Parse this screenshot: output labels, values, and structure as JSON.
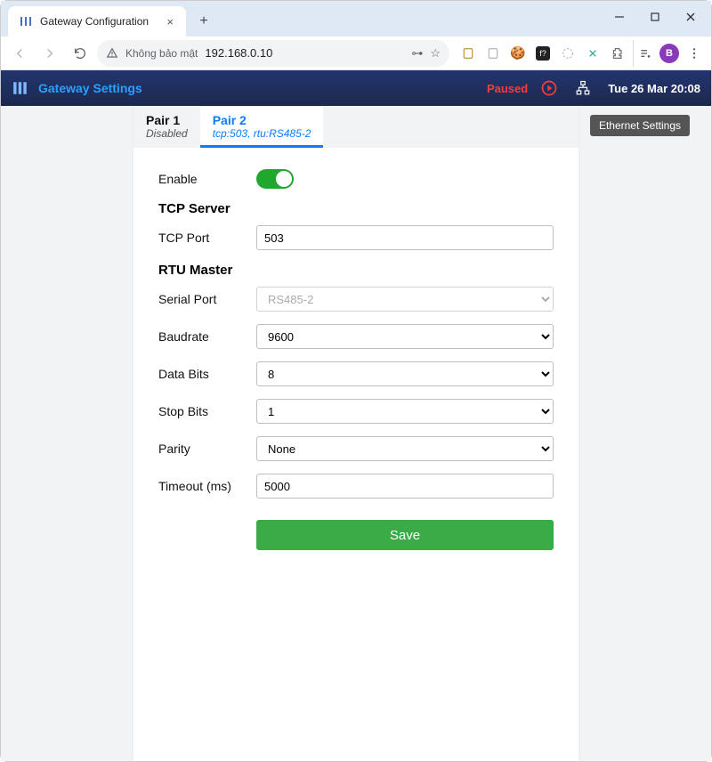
{
  "browser": {
    "tab_title": "Gateway Configuration",
    "insecure_label": "Không bảo mật",
    "address": "192.168.0.10",
    "avatar_letter": "B"
  },
  "header": {
    "title": "Gateway Settings",
    "status": "Paused",
    "datetime": "Tue 26 Mar 20:08"
  },
  "tooltip": "Ethernet Settings",
  "tabs": [
    {
      "title": "Pair 1",
      "subtitle": "Disabled"
    },
    {
      "title": "Pair 2",
      "subtitle": "tcp:503, rtu:RS485-2"
    }
  ],
  "form": {
    "enable_label": "Enable",
    "enable_on": true,
    "tcp_section": "TCP Server",
    "tcp_port_label": "TCP Port",
    "tcp_port_value": "503",
    "rtu_section": "RTU Master",
    "serial_port_label": "Serial Port",
    "serial_port_value": "RS485-2",
    "baudrate_label": "Baudrate",
    "baudrate_value": "9600",
    "databits_label": "Data Bits",
    "databits_value": "8",
    "stopbits_label": "Stop Bits",
    "stopbits_value": "1",
    "parity_label": "Parity",
    "parity_value": "None",
    "timeout_label": "Timeout (ms)",
    "timeout_value": "5000",
    "save_label": "Save"
  }
}
